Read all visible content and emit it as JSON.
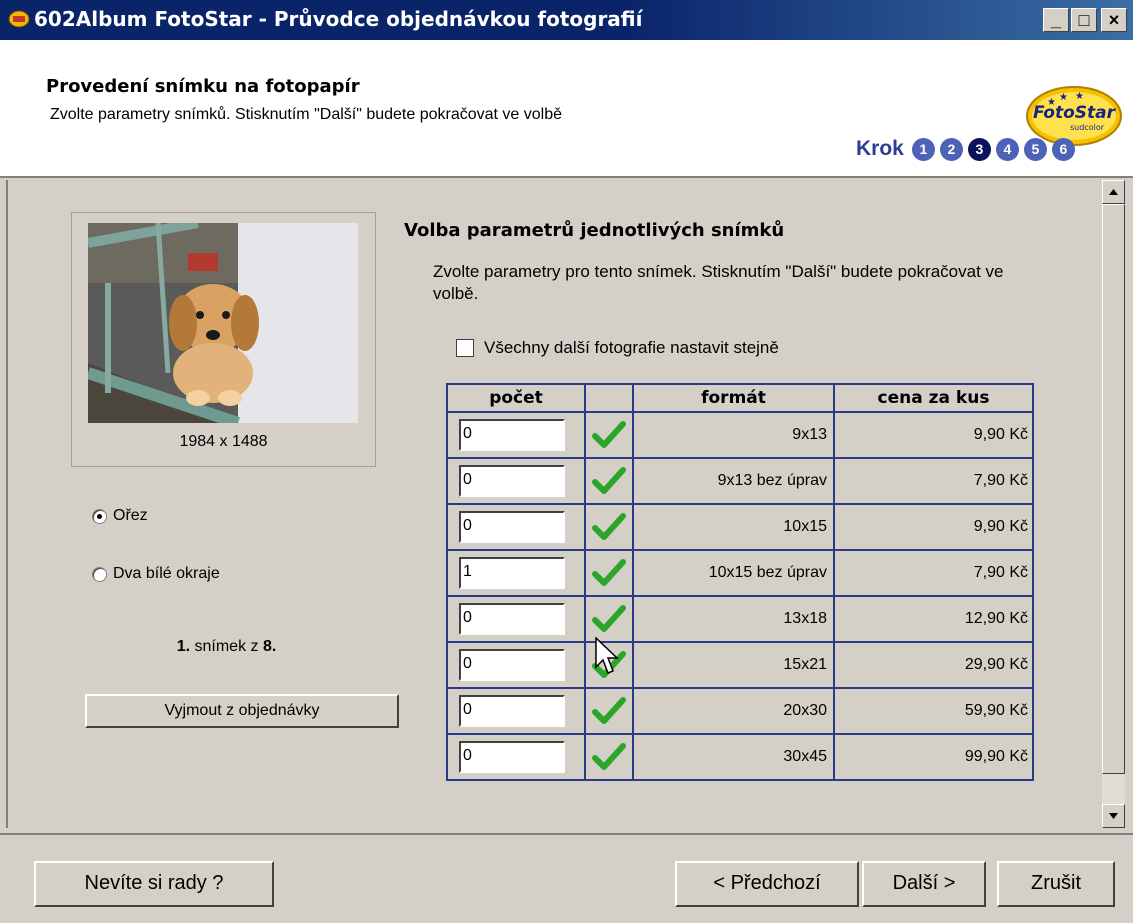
{
  "window": {
    "title": "602Album FotoStar - Průvodce objednávkou fotografií",
    "minimize": "_",
    "maximize": "□",
    "close": "×"
  },
  "header": {
    "title": "Provedení snímku na fotopapír",
    "subtitle": "Zvolte parametry snímků. Stisknutím \"Další\" budete pokračovat ve volbě",
    "logo_text": "FotoStar",
    "logo_sub": "sudcolor",
    "step_label": "Krok",
    "steps": [
      "1",
      "2",
      "3",
      "4",
      "5",
      "6"
    ],
    "current_step": 3
  },
  "left_panel": {
    "image_size": "1984 x 1488",
    "radio_crop": "Ořez",
    "radio_white_borders": "Dva bílé okraje",
    "selected_option": "Ořez",
    "count_number": "1.",
    "count_text": " snímek z ",
    "count_total": "8.",
    "remove_button": "Vyjmout z objednávky"
  },
  "right_panel": {
    "title": "Volba parametrů jednotlivých snímků",
    "description": "Zvolte parametry pro tento snímek. Stisknutím \"Další\" budete pokračovat ve volbě.",
    "same_for_all_label": "Všechny další fotografie nastavit stejně",
    "same_for_all_checked": false,
    "table": {
      "headers": [
        "počet",
        "",
        "formát",
        "cena za kus"
      ],
      "rows": [
        {
          "qty": "0",
          "format": "9x13",
          "price": "9,90 Kč"
        },
        {
          "qty": "0",
          "format": "9x13 bez úprav",
          "price": "7,90 Kč"
        },
        {
          "qty": "0",
          "format": "10x15",
          "price": "9,90 Kč"
        },
        {
          "qty": "1",
          "format": "10x15 bez úprav",
          "price": "7,90 Kč"
        },
        {
          "qty": "0",
          "format": "13x18",
          "price": "12,90 Kč"
        },
        {
          "qty": "0",
          "format": "15x21",
          "price": "29,90 Kč"
        },
        {
          "qty": "0",
          "format": "20x30",
          "price": "59,90 Kč"
        },
        {
          "qty": "0",
          "format": "30x45",
          "price": "99,90 Kč"
        }
      ]
    }
  },
  "footer": {
    "help_button": "Nevíte si rady ?",
    "prev_button": "< Předchozí",
    "next_button": "Další >",
    "cancel_button": "Zrušit"
  },
  "colors": {
    "title_bar": "#0a246a",
    "face": "#d4d0c8",
    "step_circle": "#4e63b8",
    "step_current": "#0b145a",
    "table_border": "#2b3a87",
    "check_green": "#2aa52a"
  }
}
